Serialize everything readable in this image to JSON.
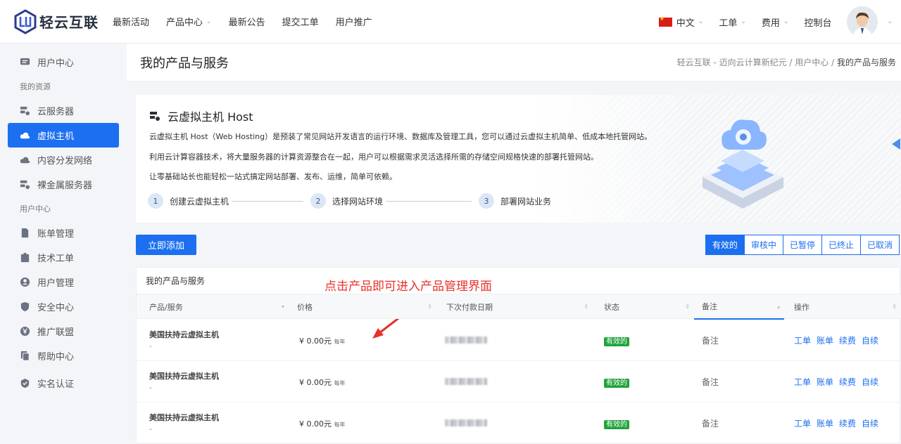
{
  "brand": {
    "name": "轻云互联"
  },
  "nav": {
    "items": [
      "最新活动",
      "产品中心",
      "最新公告",
      "提交工单",
      "用户推广"
    ],
    "right": [
      "中文",
      "工单",
      "费用",
      "控制台"
    ]
  },
  "sidebar": {
    "top": "用户中心",
    "group1": "我的资源",
    "resources": [
      "云服务器",
      "虚拟主机",
      "内容分发网络",
      "裸金属服务器"
    ],
    "group2": "用户中心",
    "user": [
      "账单管理",
      "技术工单",
      "用户管理",
      "安全中心",
      "推广联盟",
      "帮助中心",
      "实名认证"
    ]
  },
  "page": {
    "title": "我的产品与服务",
    "crumb": [
      "轻云互联 - 迈向云计算新纪元",
      "用户中心",
      "我的产品与服务"
    ]
  },
  "hero": {
    "title": "云虚拟主机 Host",
    "p1": "云虚拟主机 Host（Web Hosting）是预装了常见网站开发语言的运行环境、数据库及管理工具，您可以通过云虚拟主机简单、低成本地托管网站。",
    "p2": "利用云计算容器技术，将大量服务器的计算资源整合在一起，用户可以根据需求灵活选择所需的存储空间规格快速的部署托管网站。",
    "p3": "让零基础站长也能轻松一站式搞定网站部署、发布、运维，简单可依赖。",
    "steps": [
      {
        "n": "1",
        "label": "创建云虚拟主机"
      },
      {
        "n": "2",
        "label": "选择网站环境"
      },
      {
        "n": "3",
        "label": "部署网站业务"
      }
    ]
  },
  "actions": {
    "add": "立即添加",
    "filters": [
      "有效的",
      "审核中",
      "已暂停",
      "已终止",
      "已取消"
    ]
  },
  "table": {
    "title": "我的产品与服务",
    "annotation": "点击产品即可进入产品管理界面",
    "headers": [
      "产品/服务",
      "价格",
      "下次付款日期",
      "状态",
      "备注",
      "操作"
    ],
    "rows": [
      {
        "name": "美国扶持云虚拟主机",
        "sub": "-",
        "price": "¥ 0.00元",
        "cycle": "每年",
        "status": "有效的",
        "memo": "备注",
        "ops": [
          "工单",
          "账单",
          "续费",
          "自续"
        ]
      },
      {
        "name": "美国扶持云虚拟主机",
        "sub": "-",
        "price": "¥ 0.00元",
        "cycle": "每年",
        "status": "有效的",
        "memo": "备注",
        "ops": [
          "工单",
          "账单",
          "续费",
          "自续"
        ]
      },
      {
        "name": "美国扶持云虚拟主机",
        "sub": "-",
        "price": "¥ 0.00元",
        "cycle": "每年",
        "status": "有效的",
        "memo": "备注",
        "ops": [
          "工单",
          "账单",
          "续费",
          "自续"
        ]
      }
    ]
  }
}
